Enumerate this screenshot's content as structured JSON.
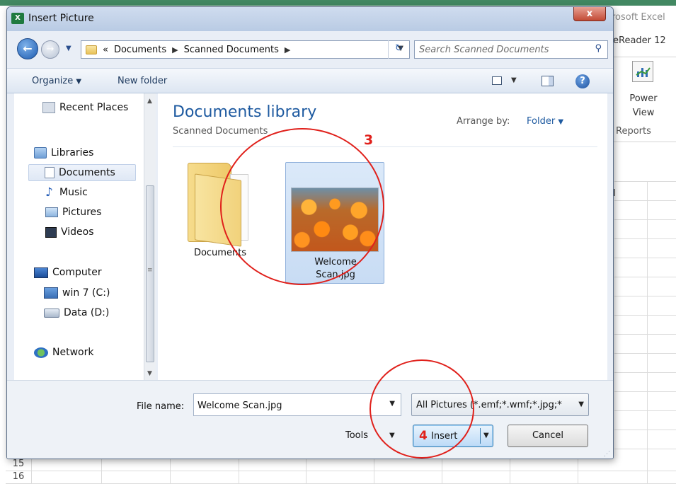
{
  "excel_background": {
    "app_title": "rosoft Excel",
    "addin_label": "eReader 12",
    "power_view_label": "Power View",
    "reports_label": "Reports",
    "column_header": "I",
    "row_15": "15",
    "row_16": "16"
  },
  "dialog": {
    "title": "Insert Picture",
    "close_symbol": "x",
    "address": {
      "prefix": "«",
      "segments": [
        "Documents",
        "Scanned Documents"
      ]
    },
    "search": {
      "placeholder": "Search Scanned Documents"
    },
    "toolbar": {
      "organize_label": "Organize",
      "new_folder_label": "New folder"
    },
    "nav_pane": {
      "recent_places": "Recent Places",
      "libraries": "Libraries",
      "documents": "Documents",
      "music": "Music",
      "pictures": "Pictures",
      "videos": "Videos",
      "computer": "Computer",
      "drive_c": "win 7 (C:)",
      "drive_d": "Data (D:)",
      "network": "Network"
    },
    "content": {
      "library_title": "Documents library",
      "library_subtitle": "Scanned Documents",
      "arrange_by_label": "Arrange by:",
      "arrange_by_value": "Folder",
      "items": [
        {
          "name": "Documents",
          "type": "folder"
        },
        {
          "name_line1": "Welcome",
          "name_line2": "Scan.jpg",
          "type": "image",
          "selected": true
        }
      ]
    },
    "bottom": {
      "file_name_label": "File name:",
      "file_name_value": "Welcome Scan.jpg",
      "filter_value": "All Pictures (*.emf;*.wmf;*.jpg;*",
      "tools_label": "Tools",
      "insert_label": "Insert",
      "cancel_label": "Cancel"
    }
  },
  "annotations": {
    "step3": "3",
    "step4": "4",
    "color": "#e0201b"
  },
  "colors": {
    "accent": "#1e5aa0",
    "excel_green": "#217346"
  }
}
